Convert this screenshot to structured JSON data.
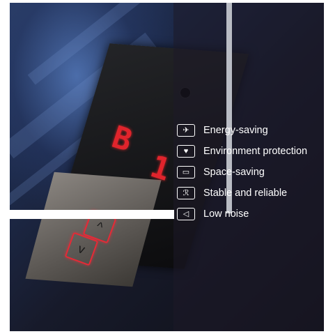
{
  "display": {
    "floor_letter": "B",
    "floor_number": "1"
  },
  "buttons": {
    "up_symbol": "^",
    "down_symbol": "v"
  },
  "features": [
    {
      "icon": "fan-icon",
      "glyph": "✈",
      "label": "Energy-saving"
    },
    {
      "icon": "leaf-icon",
      "glyph": "♥",
      "label": "Environment protection"
    },
    {
      "icon": "box-icon",
      "glyph": "▭",
      "label": "Space-saving"
    },
    {
      "icon": "shield-icon",
      "glyph": "ℛ",
      "label": "Stable and reliable"
    },
    {
      "icon": "speaker-icon",
      "glyph": "◁",
      "label": "Low noise"
    }
  ],
  "colors": {
    "display_red": "#e0242c",
    "button_outline": "#e52a36",
    "text": "#ffffff"
  }
}
